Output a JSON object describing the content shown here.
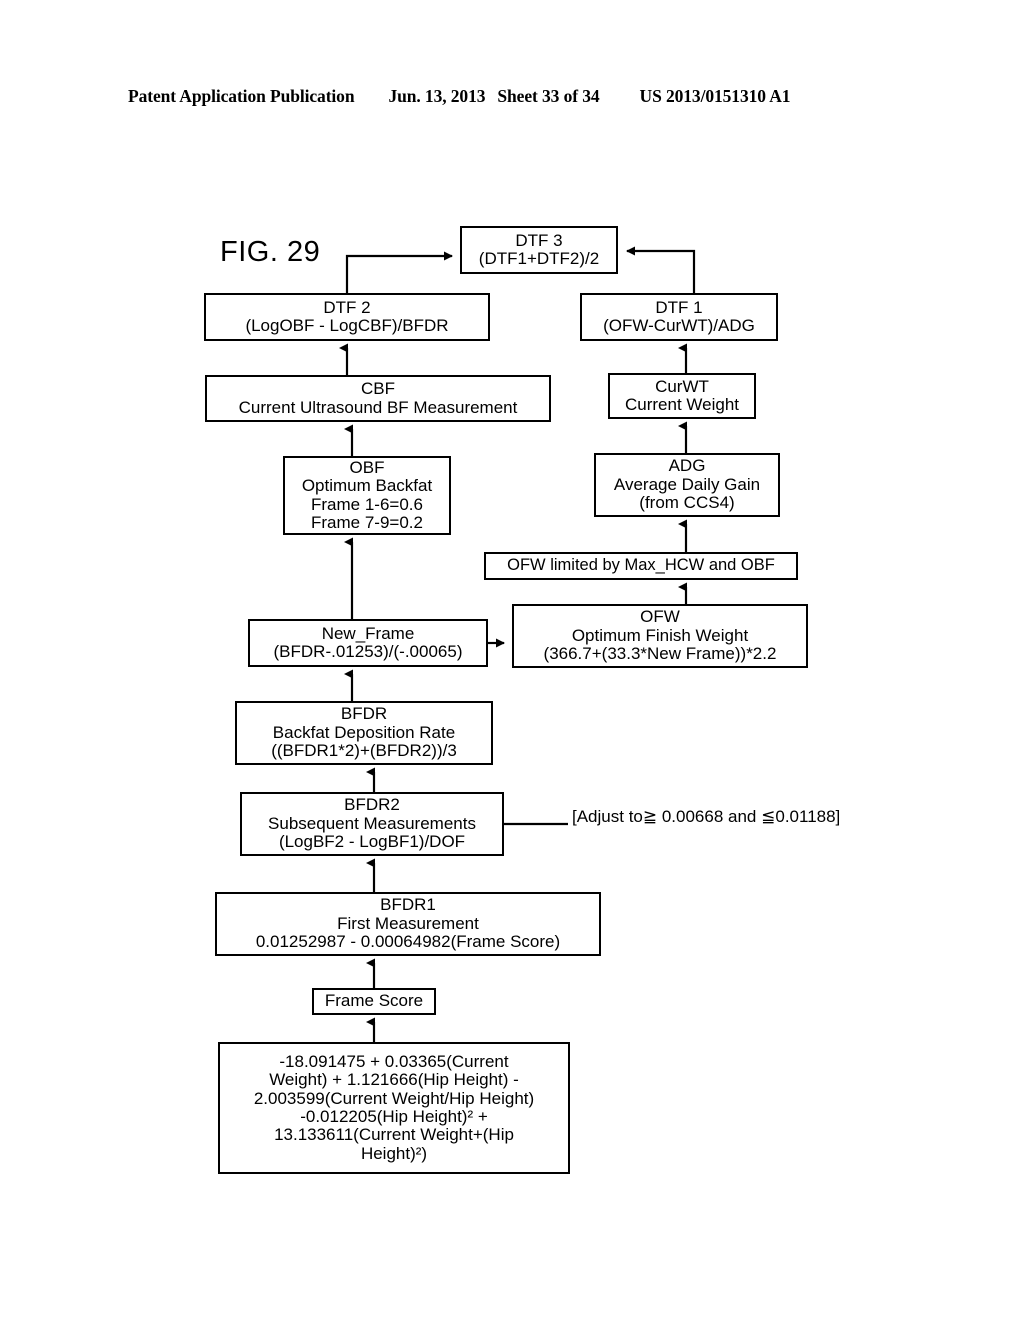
{
  "header": {
    "title": "Patent Application Publication",
    "date": "Jun. 13, 2013",
    "sheet": "Sheet 33 of 34",
    "publication_number": "US 2013/0151310 A1"
  },
  "figure": {
    "label": "FIG. 29"
  },
  "nodes": {
    "dtf3": {
      "line1": "DTF 3",
      "line2": "(DTF1+DTF2)/2"
    },
    "dtf2": {
      "line1": "DTF 2",
      "line2": "(LogOBF - LogCBF)/BFDR"
    },
    "dtf1": {
      "line1": "DTF 1",
      "line2": "(OFW-CurWT)/ADG"
    },
    "cbf": {
      "line1": "CBF",
      "line2": "Current Ultrasound BF Measurement"
    },
    "curwt": {
      "line1": "CurWT",
      "line2": "Current Weight"
    },
    "obf": {
      "line1": "OBF",
      "line2": "Optimum Backfat",
      "line3": "Frame 1-6=0.6",
      "line4": "Frame 7-9=0.2"
    },
    "adg": {
      "line1": "ADG",
      "line2": "Average Daily Gain",
      "line3": "(from CCS4)"
    },
    "ofw_limited": {
      "line1": "OFW limited by Max_HCW and OBF"
    },
    "new_frame": {
      "line1": "New_Frame",
      "line2": "(BFDR-.01253)/(-.00065)"
    },
    "ofw": {
      "line1": "OFW",
      "line2": "Optimum Finish Weight",
      "line3": "(366.7+(33.3*New Frame))*2.2"
    },
    "bfdr": {
      "line1": "BFDR",
      "line2": "Backfat Deposition Rate",
      "line3": "((BFDR1*2)+(BFDR2))/3"
    },
    "bfdr2": {
      "line1": "BFDR2",
      "line2": "Subsequent Measurements",
      "line3": "(LogBF2 - LogBF1)/DOF"
    },
    "bfdr1": {
      "line1": "BFDR1",
      "line2": "First Measurement",
      "line3": "0.01252987 - 0.00064982(Frame Score)"
    },
    "frame_score": {
      "line1": "Frame Score"
    },
    "frame_formula": {
      "line1": "-18.091475 + 0.03365(Current",
      "line2": "Weight) + 1.121666(Hip Height) -",
      "line3": "2.003599(Current Weight/Hip Height)",
      "line4": "-0.012205(Hip Height)² +",
      "line5": "13.133611(Current Weight+(Hip",
      "line6": "Height)²)"
    }
  },
  "annotations": {
    "bfdr2_adjust_line1": "[Adjust to≧ 0.00668 and",
    "bfdr2_adjust_line2": "≦0.01188]"
  },
  "colors": {
    "ink": "#000000",
    "page": "#ffffff"
  }
}
